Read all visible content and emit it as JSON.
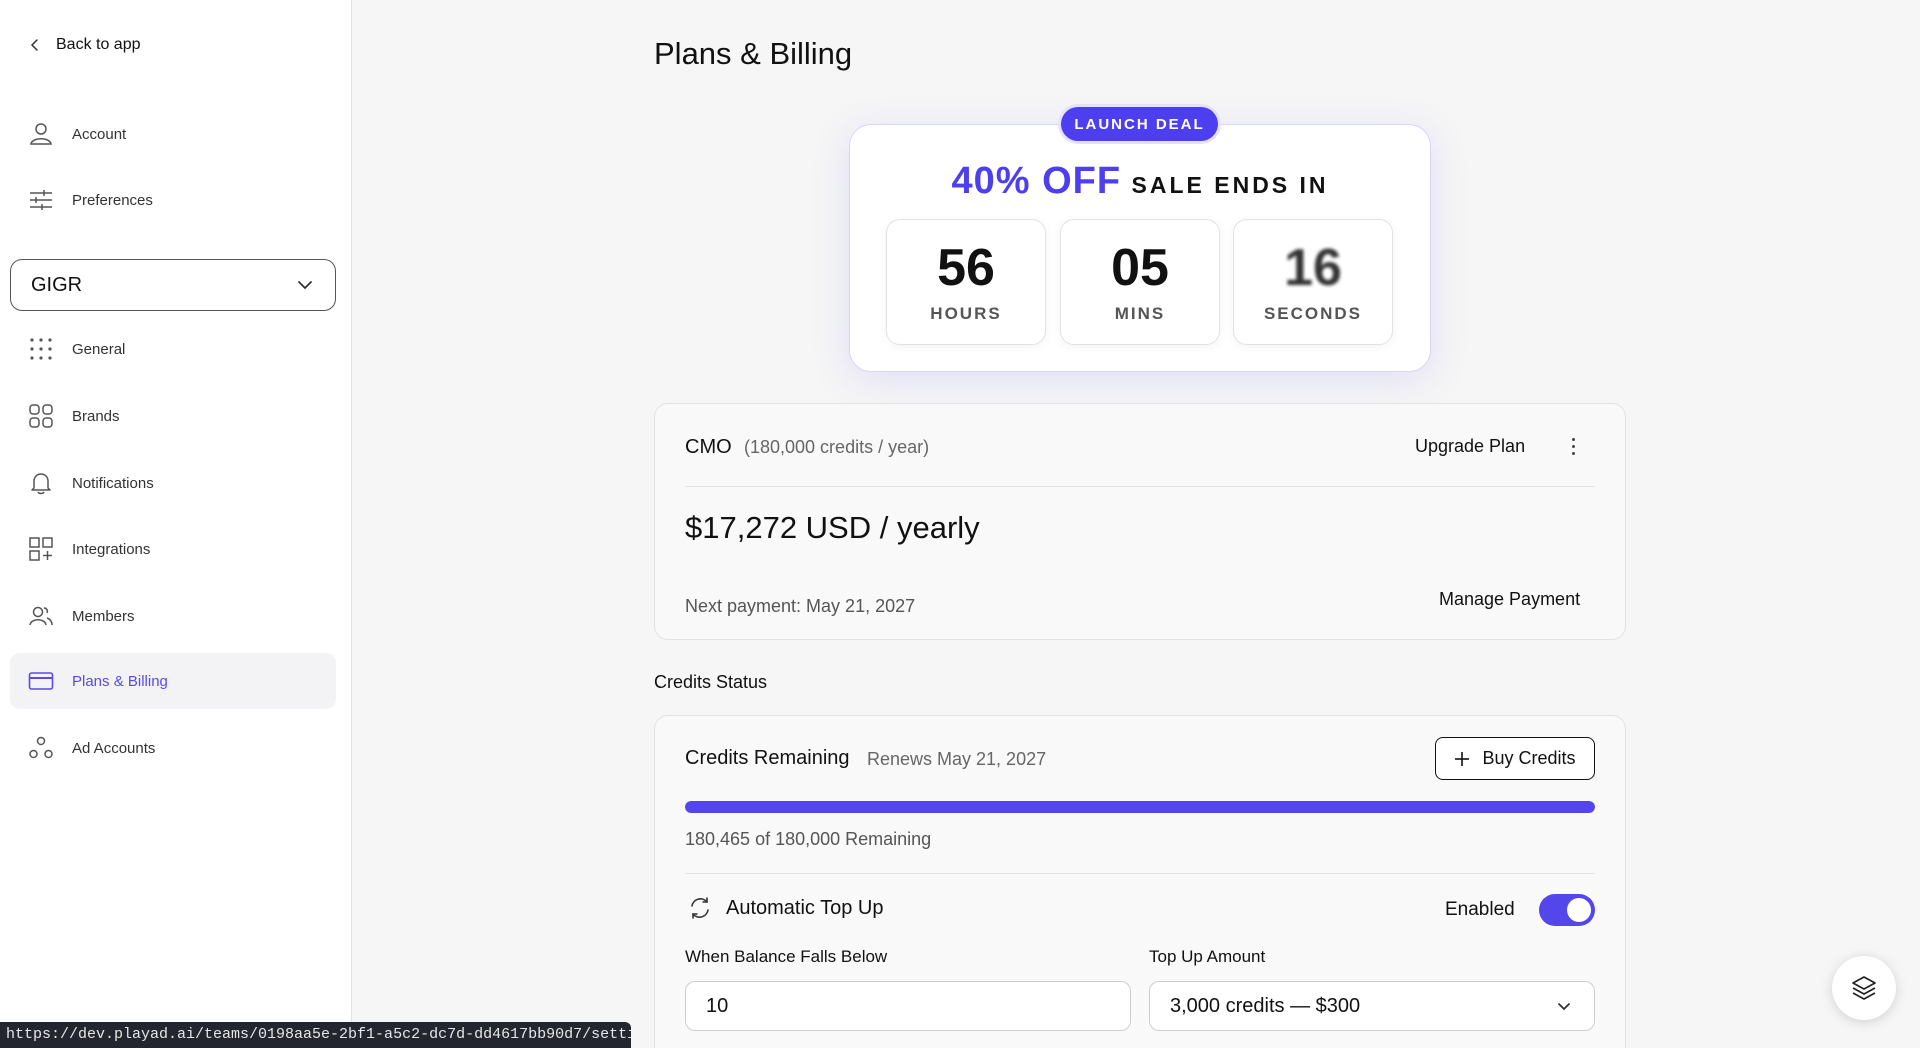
{
  "sidebar": {
    "back_label": "Back to app",
    "account_items": [
      {
        "label": "Account",
        "icon": "user-icon"
      },
      {
        "label": "Preferences",
        "icon": "sliders-icon"
      }
    ],
    "team_select": {
      "value": "GIGR"
    },
    "team_items": [
      {
        "label": "General",
        "icon": "dots-grid-icon"
      },
      {
        "label": "Brands",
        "icon": "brands-grid-icon"
      },
      {
        "label": "Notifications",
        "icon": "bell-icon"
      },
      {
        "label": "Integrations",
        "icon": "integrations-icon"
      },
      {
        "label": "Members",
        "icon": "members-icon"
      },
      {
        "label": "Plans & Billing",
        "icon": "credit-card-icon",
        "active": true
      },
      {
        "label": "Ad Accounts",
        "icon": "ad-accounts-icon"
      }
    ]
  },
  "page": {
    "title": "Plans & Billing"
  },
  "promo": {
    "badge": "LAUNCH DEAL",
    "discount": "40% OFF",
    "ends_text": "SALE ENDS IN",
    "countdown": [
      {
        "value": "56",
        "label": "HOURS"
      },
      {
        "value": "05",
        "label": "MINS"
      },
      {
        "value": "16",
        "label": "SECONDS"
      }
    ]
  },
  "plan": {
    "name": "CMO",
    "credits": "(180,000 credits / year)",
    "upgrade_label": "Upgrade Plan",
    "price": "$17,272 USD / yearly",
    "next_payment": "Next payment: May 21, 2027",
    "manage_label": "Manage Payment"
  },
  "credits": {
    "section_title": "Credits Status",
    "title": "Credits Remaining",
    "renews": "Renews May 21, 2027",
    "buy_label": "Buy Credits",
    "progress_fraction": 1.0,
    "remaining_text": "180,465 of 180,000 Remaining",
    "topup": {
      "title": "Automatic Top Up",
      "status_label": "Enabled",
      "enabled": true,
      "threshold_label": "When Balance Falls Below",
      "threshold_value": "10",
      "amount_label": "Top Up Amount",
      "amount_value": "3,000 credits — $300"
    }
  },
  "status_bar": {
    "url": "https://dev.playad.ai/teams/0198aa5e-2bf1-a5c2-dc7d-dd4617bb90d7/settings/plans"
  },
  "colors": {
    "accent": "#5346ea",
    "background": "#f6f6f6",
    "sidebar_active_bg": "#f3f3f6"
  }
}
